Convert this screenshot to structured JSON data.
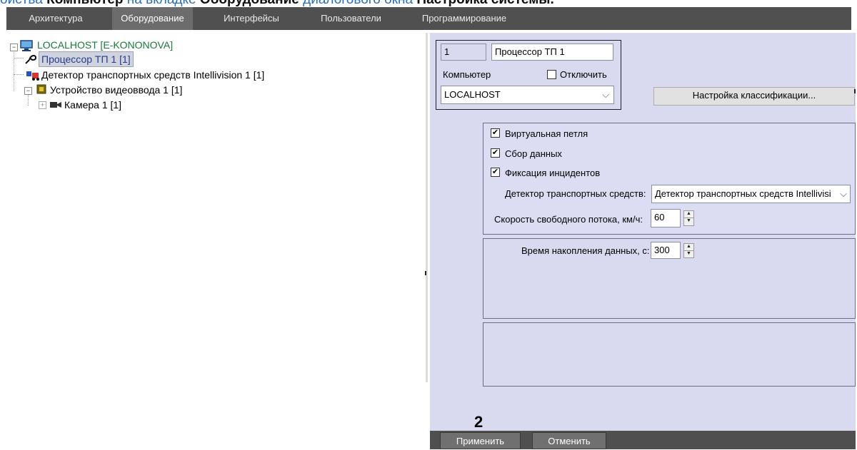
{
  "doc": {
    "prefix": "ойства ",
    "bold1": "Компьютер",
    "mid1": " на вкладке ",
    "bold2": "Оборудование",
    "mid2": " диалогового окна ",
    "bold3": "Настройка системы."
  },
  "tabs": [
    {
      "label": "Архитектура"
    },
    {
      "label": "Оборудование"
    },
    {
      "label": "Интерфейсы"
    },
    {
      "label": "Пользователи"
    },
    {
      "label": "Программирование"
    }
  ],
  "tree": {
    "root": "LOCALHOST [E-KONONOVA]",
    "processor": "Процессор ТП 1 [1]",
    "detector": "Детектор транспортных средств Intellivision 1 [1]",
    "video_input": "Устройство видеоввода 1 [1]",
    "camera": "Камера 1 [1]"
  },
  "object": {
    "id": "1",
    "name": "Процессор ТП 1",
    "computer_label": "Компьютер",
    "disable_label": "Отключить",
    "disable_checked": false,
    "computer_value": "LOCALHOST",
    "classification_button": "Настройка классификации..."
  },
  "settings": {
    "virtual_loop": {
      "label": "Виртуальная петля",
      "checked": true
    },
    "data_collection": {
      "label": "Сбор данных",
      "checked": true
    },
    "incidents": {
      "label": "Фиксация инцидентов",
      "checked": true
    },
    "detector_label": "Детектор транспортных средств:",
    "detector_value": "Детектор транспортных средств Intellivisi",
    "speed_label": "Скорость свободного потока, км/ч:",
    "speed_value": "60",
    "accumulation_label": "Время накопления данных, с:",
    "accumulation_value": "300"
  },
  "annotation": "2",
  "footer": {
    "apply": "Применить",
    "cancel": "Отменить"
  },
  "colors": {
    "tab_bar": "#505050",
    "tab_active": "#6c6c6c",
    "panel_bg": "#d9d9ef",
    "link_blue": "#2a6fb8",
    "root_green": "#1a7a3a"
  }
}
